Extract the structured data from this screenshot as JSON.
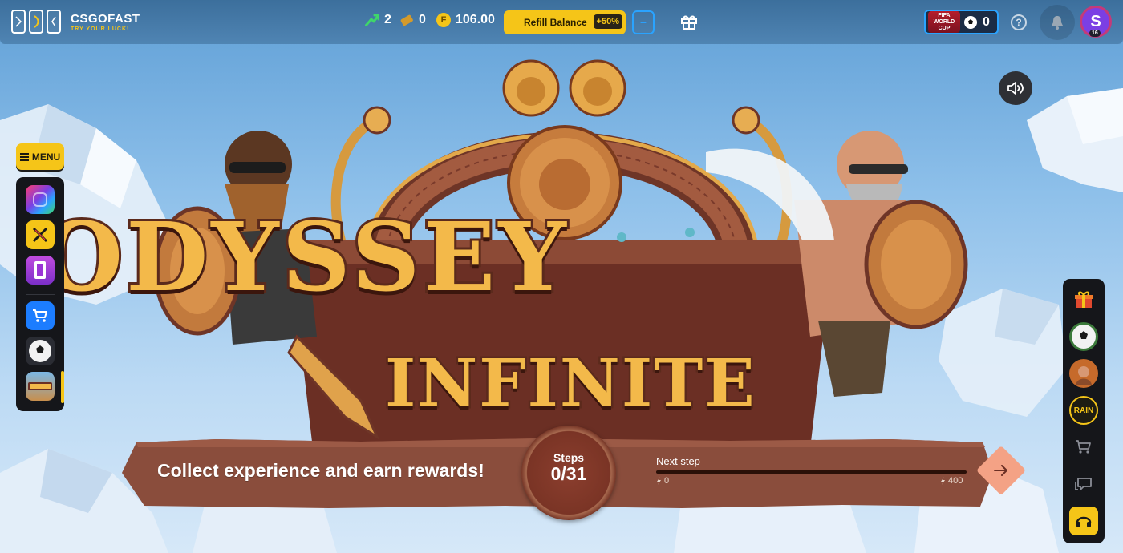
{
  "brand": {
    "title": "CSGOFAST",
    "tagline": "TRY YOUR LUCK!"
  },
  "header": {
    "stats": [
      {
        "icon": "arrow-up-icon",
        "value": "2"
      },
      {
        "icon": "ticket-icon",
        "value": "0"
      },
      {
        "icon": "coin-icon",
        "coin_letter": "F",
        "value": "106.00"
      }
    ],
    "refill_label": "Refill Balance",
    "refill_bonus": "+50%",
    "minus_label": "−",
    "fifa_logo_text": "FIFA WORLD CUP",
    "fifa_count": "0",
    "help_label": "?",
    "avatar_letter": "S",
    "avatar_level": "16"
  },
  "menu": {
    "label": "MENU"
  },
  "left_rail": {
    "items": [
      {
        "name": "game-colors",
        "active": false
      },
      {
        "name": "game-swords",
        "active": false
      },
      {
        "name": "game-door",
        "active": false
      },
      {
        "name": "shop",
        "active": false
      },
      {
        "name": "football",
        "active": false
      },
      {
        "name": "odyssey-infinite",
        "active": true
      }
    ]
  },
  "right_rail": {
    "items": [
      "gift",
      "football",
      "avatar-fighter",
      "rain",
      "cart",
      "chat",
      "support"
    ],
    "rain_label": "RAIN"
  },
  "hero": {
    "title_line1": "ODYSSEY",
    "title_line2": "INFINITE"
  },
  "banner": {
    "text": "Collect experience and earn rewards!",
    "steps_label": "Steps",
    "steps_value": "0/31",
    "next_step_label": "Next step",
    "progress_min": "0",
    "progress_max": "400",
    "progress_fraction": 0
  },
  "colors": {
    "accent": "#f5c518",
    "brand_blue": "#2aa3ff",
    "banner_brown": "#8a4d3c",
    "title_gold": "#f3b94a"
  }
}
